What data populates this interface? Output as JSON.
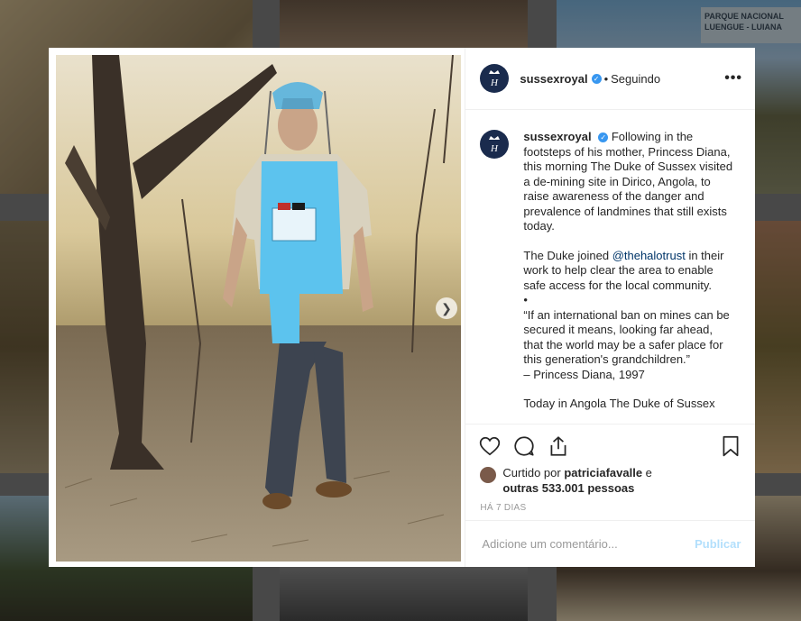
{
  "background": {
    "sign_text": "PARQUE NACIONAL\nLUENGUE - LUIANA"
  },
  "post": {
    "username": "sussexroyal",
    "follow_separator": "•",
    "follow_status": "Seguindo",
    "more_icon": "more-dots-icon",
    "caption": {
      "username": "sussexroyal",
      "paragraph1": "Following in the footsteps of his mother, Princess Diana, this morning The Duke of Sussex visited a de-mining site in Dirico, Angola, to raise awareness of the danger and prevalence of landmines that still exists today.",
      "paragraph2_before": "The Duke joined ",
      "mention": "@thehalotrust",
      "paragraph2_after": " in their work to help clear the area to enable safe access for the local community.",
      "bullet": "•",
      "quote": "“If an international ban on mines can be secured it means, looking far ahead, that the world may be a safer place for this generation's grandchildren.”",
      "attribution": "– Princess Diana, 1997",
      "cut_line": "Today in Angola The Duke of Sussex"
    },
    "likes": {
      "prefix": "Curtido por ",
      "liker": "patriciafavalle",
      "connector": " e",
      "others": "outras 533.001 pessoas"
    },
    "time_ago": "HÁ 7 DIAS",
    "comment_placeholder": "Adicione um comentário...",
    "publish_label": "Publicar",
    "next_icon": "chevron-right-icon"
  },
  "colors": {
    "link_blue": "#003569",
    "verified_blue": "#3897f0",
    "publish_disabled": "#b2dffc",
    "avatar_navy": "#1a2b4d"
  }
}
